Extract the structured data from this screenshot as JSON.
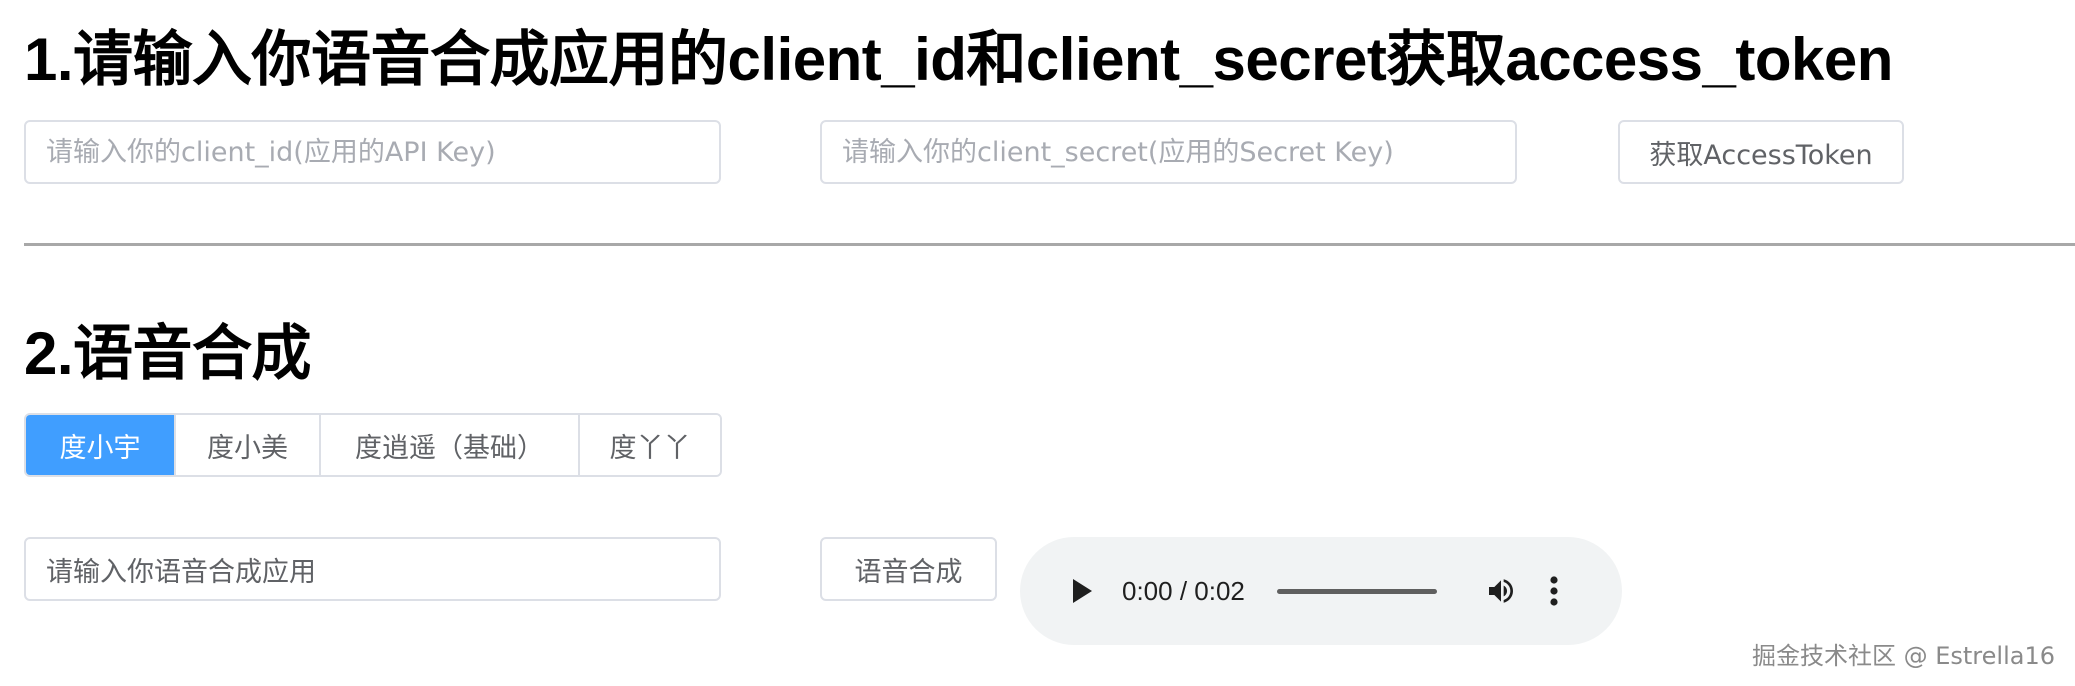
{
  "section1": {
    "title": "1.请输入你语音合成应用的client_id和client_secret获取access_token",
    "client_id_placeholder": "请输入你的client_id(应用的API Key)",
    "client_secret_placeholder": "请输入你的client_secret(应用的Secret Key)",
    "get_token_label": "获取AccessToken"
  },
  "section2": {
    "title": "2.语音合成",
    "voices": [
      {
        "label": "度小宇",
        "selected": true
      },
      {
        "label": "度小美",
        "selected": false
      },
      {
        "label": "度逍遥（基础）",
        "selected": false
      },
      {
        "label": "度丫丫",
        "selected": false
      }
    ],
    "text_input_value": "请输入你语音合成应用",
    "synthesize_label": "语音合成",
    "audio": {
      "time_display": "0:00 / 0:02",
      "play_icon": "play-icon",
      "volume_icon": "volume-icon",
      "more_icon": "more-vertical-icon"
    }
  },
  "watermark": "掘金技术社区 @ Estrella16",
  "colors": {
    "accent": "#409eff",
    "border": "#dcdfe6",
    "divider": "#a8a8a8",
    "player_bg": "#f1f3f4"
  }
}
